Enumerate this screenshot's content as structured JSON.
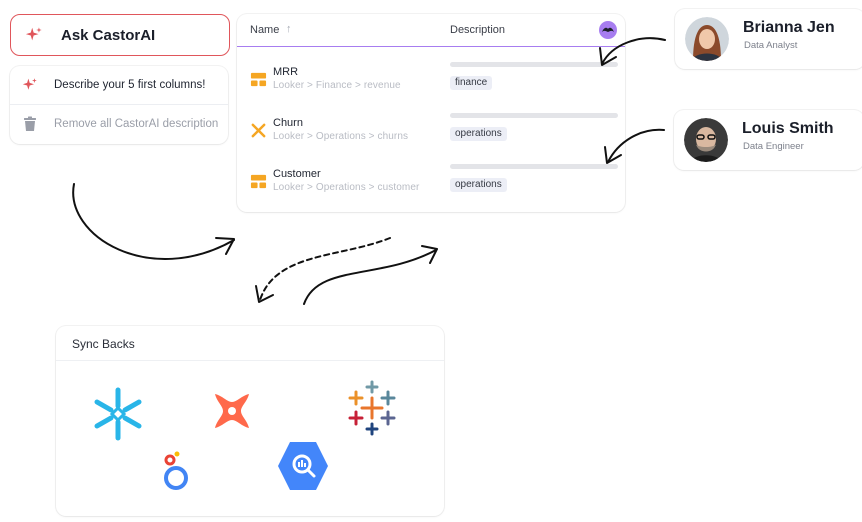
{
  "ask_button": {
    "label": "Ask CastorAI",
    "icon": "sparkle-icon"
  },
  "menu": {
    "items": [
      {
        "label": "Describe your 5 first columns!",
        "icon": "sparkle-icon"
      },
      {
        "label": "Remove all CastorAI description",
        "icon": "trash-icon"
      }
    ]
  },
  "table": {
    "columns": {
      "name": "Name",
      "description": "Description"
    },
    "sort_indicator": "↑",
    "rows": [
      {
        "name": "MRR",
        "path": "Looker > Finance > revenue",
        "tag": "finance",
        "icon": "dashboard-icon"
      },
      {
        "name": "Churn",
        "path": "Looker > Operations > churns",
        "tag": "operations",
        "icon": "x-icon"
      },
      {
        "name": "Customer",
        "path": "Looker > Operations > customer",
        "tag": "operations",
        "icon": "dashboard-icon"
      }
    ]
  },
  "people": [
    {
      "name": "Brianna Jen",
      "role": "Data Analyst"
    },
    {
      "name": "Louis Smith",
      "role": "Data Engineer"
    }
  ],
  "sync": {
    "title": "Sync Backs",
    "logos": [
      "snowflake-logo",
      "dbt-logo",
      "tableau-logo",
      "looker-logo",
      "bigquery-logo"
    ]
  },
  "colors": {
    "accent_red": "#e0565b",
    "accent_purple": "#a77df0",
    "looker_orange": "#f5a623",
    "snowflake_blue": "#29b5e8",
    "dbt_orange": "#ff694b",
    "bigquery_blue": "#4386fa"
  }
}
